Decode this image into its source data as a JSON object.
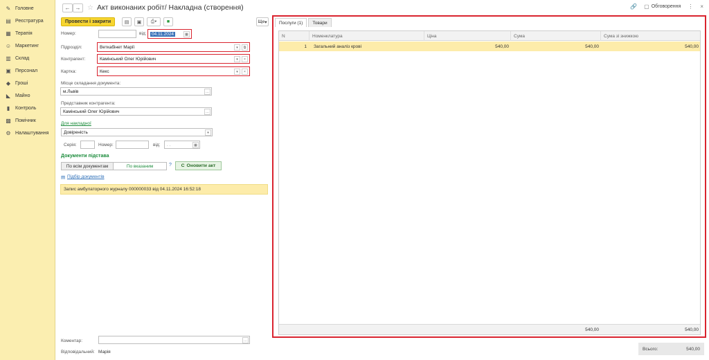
{
  "sidebar": {
    "items": [
      {
        "label": "Головне",
        "icon": "pencil-icon"
      },
      {
        "label": "Реєстратура",
        "icon": "registry-icon"
      },
      {
        "label": "Терапія",
        "icon": "therapy-icon"
      },
      {
        "label": "Маркетинг",
        "icon": "marketing-icon"
      },
      {
        "label": "Склад",
        "icon": "warehouse-icon"
      },
      {
        "label": "Персонал",
        "icon": "staff-icon"
      },
      {
        "label": "Гроші",
        "icon": "money-icon"
      },
      {
        "label": "Майно",
        "icon": "property-icon"
      },
      {
        "label": "Контроль",
        "icon": "control-icon"
      },
      {
        "label": "Помічник",
        "icon": "assistant-icon"
      },
      {
        "label": "Налаштування",
        "icon": "wrench-icon"
      }
    ]
  },
  "header": {
    "title": "Акт виконаних робіт/ Накладна (створення)",
    "discussions": "Обговорення"
  },
  "toolbar": {
    "post_close": "Провести і закрити",
    "more": "Ще"
  },
  "form": {
    "number_label": "Номер:",
    "number_value": "",
    "date_from_label": "від:",
    "date_value": "04.11.2024",
    "department_label": "Підрозділ:",
    "department_value": "Веткабінет Марії",
    "counterparty_label": "Контрагент:",
    "counterparty_value": "Камінський Олег Юрійович",
    "card_label": "Картка:",
    "card_value": "Кекс",
    "place_label": "Місце складання документа:",
    "place_value": "м.Львів",
    "representative_label": "Представник контрагента:",
    "representative_value": "Камінський Олег Юрійович",
    "invoice_link": "Для накладної",
    "power_of_attorney": "Довіреність",
    "series_label": "Серія:",
    "series_value": "",
    "num2_label": "Номер:",
    "num2_value": "",
    "from2_label": "від:",
    "date2_placeholder": ". .",
    "basis_docs_heading": "Документи підстава",
    "by_all_docs": "По всім документам",
    "by_specified": "По вказаним",
    "help": "?",
    "refresh_act": "Оновити акт",
    "select_docs_link": "Підбір документів",
    "basis_record": "Запис амбулаторного журналу 000000033 від 04.11.2024 16:52:18",
    "comment_label": "Коментар:",
    "comment_value": "",
    "responsible_label": "Відповідальний:",
    "responsible_value": "Марія"
  },
  "tabs": [
    {
      "label": "Послуги (1)",
      "active": true
    },
    {
      "label": "Товари",
      "active": false
    }
  ],
  "table": {
    "columns": [
      "N",
      "Номенклатура",
      "Ціна",
      "Сума",
      "Сума зі знижкою"
    ],
    "rows": [
      {
        "n": "1",
        "item": "Загальний аналіз крові",
        "price": "540,00",
        "sum": "540,00",
        "discount_sum": "540,00"
      }
    ],
    "footer": {
      "sum": "540,00",
      "discount_sum": "540,00"
    }
  },
  "total": {
    "label": "Всього:",
    "value": "540,00"
  }
}
